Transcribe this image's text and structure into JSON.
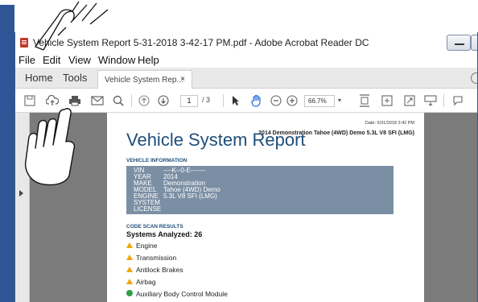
{
  "window": {
    "title": "Vehicle System Report 5-31-2018 3-42-17 PM.pdf - Adobe Acrobat Reader DC"
  },
  "menu": [
    "File",
    "Edit",
    "View",
    "Window",
    "Help"
  ],
  "nav": {
    "home": "Home",
    "tools": "Tools"
  },
  "doc_tab": {
    "label": "Vehicle System Rep...",
    "close": "×"
  },
  "toolbar": {
    "page_current": "1",
    "page_total": "/ 3",
    "zoom": "66.7%",
    "zoom_arrow": "▾"
  },
  "report": {
    "date": "Date: 5/31/2018 3:42 PM",
    "subtitle": "2014 Demonstration Tahoe (4WD) Demo 5.3L V8 SFI (LMG)",
    "title": "Vehicle System Report",
    "vehicle_info_head": "VEHICLE INFORMATION",
    "vehicle_info": [
      {
        "label": "VIN",
        "value": "----K--0-E-------"
      },
      {
        "label": "YEAR",
        "value": "2014"
      },
      {
        "label": "MAKE",
        "value": "Demonstration"
      },
      {
        "label": "MODEL",
        "value": "Tahoe (4WD) Demo"
      },
      {
        "label": "ENGINE",
        "value": "5.3L V8 SFI (LMG)"
      },
      {
        "label": "SYSTEM",
        "value": ""
      },
      {
        "label": "LICENSE",
        "value": ""
      }
    ],
    "code_scan_head": "CODE SCAN RESULTS",
    "systems_analyzed": "Systems Analyzed: 26",
    "systems": [
      {
        "name": "Engine",
        "status": "warning"
      },
      {
        "name": "Transmission",
        "status": "warning"
      },
      {
        "name": "Antilock Brakes",
        "status": "warning"
      },
      {
        "name": "Airbag",
        "status": "warning"
      },
      {
        "name": "Auxiliary Body Control Module",
        "status": "ok"
      }
    ]
  },
  "colors": {
    "accent": "#1f4e79",
    "info_box": "#7b8fa4",
    "warning": "#f0a500",
    "ok": "#2e9e45",
    "frame_blue": "#2f5597"
  }
}
